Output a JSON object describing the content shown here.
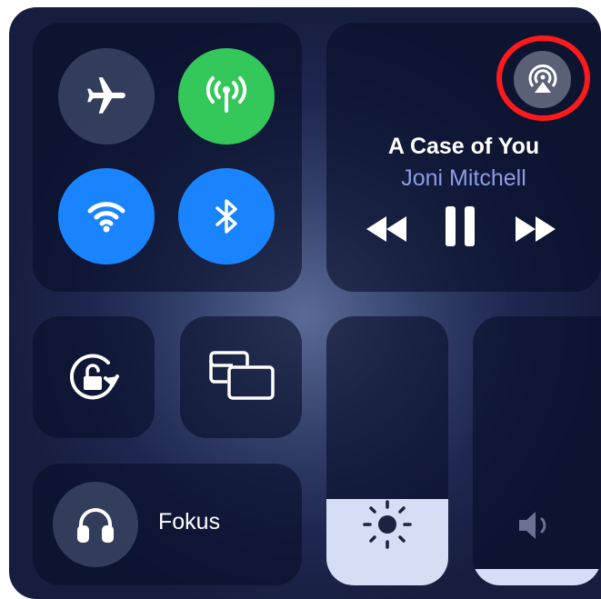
{
  "connectivity": {
    "airplane": {
      "icon": "airplane-icon",
      "on": false
    },
    "cellular": {
      "icon": "cellular-antenna-icon",
      "on": true
    },
    "wifi": {
      "icon": "wifi-icon",
      "on": true
    },
    "bluetooth": {
      "icon": "bluetooth-icon",
      "on": true
    }
  },
  "now_playing": {
    "title": "A Case of You",
    "artist": "Joni Mitchell",
    "airplay_icon": "airplay-audio-icon",
    "controls": [
      "rewind-icon",
      "pause-icon",
      "fast-forward-icon"
    ]
  },
  "tiles": {
    "orientation_lock_icon": "orientation-lock-icon",
    "screen_mirroring_icon": "screen-mirroring-icon"
  },
  "focus": {
    "label": "Fokus",
    "icon": "headphones-icon"
  },
  "brightness": {
    "level": 0.32,
    "icon": "sun-icon"
  },
  "volume": {
    "level": 0.06,
    "icon": "speaker-icon"
  },
  "highlight": {
    "color": "#ff1a1a",
    "target": "airplay-button"
  },
  "colors": {
    "green": "#34c759",
    "blue": "#1a84ff",
    "artist_text": "#8a9ce6",
    "slider_fill": "#d6def5"
  }
}
